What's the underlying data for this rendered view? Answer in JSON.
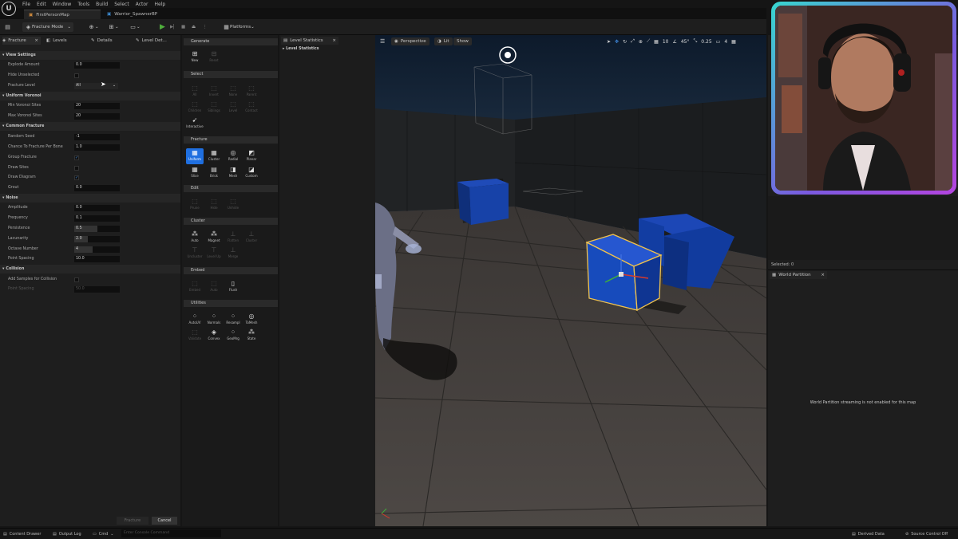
{
  "menubar": {
    "items": [
      "File",
      "Edit",
      "Window",
      "Tools",
      "Build",
      "Select",
      "Actor",
      "Help"
    ]
  },
  "logo": "U",
  "doc_tabs": [
    "FirstPersonMap",
    "Warrior_SpawnerBP"
  ],
  "toolbar": {
    "mode": "Fracture Mode",
    "platforms": "Platforms",
    "icons": [
      "save-icon",
      "mode-icon",
      "add-content-icon",
      "blueprint-icon",
      "cinematics-icon",
      "play-icon",
      "step-icon",
      "stop-icon",
      "eject-icon",
      "more-icon",
      "platforms-icon"
    ]
  },
  "panel_tabs": [
    "Fracture",
    "Levels",
    "Details",
    "Level Det..."
  ],
  "sections": {
    "view": "View Settings",
    "uniform": "Uniform Voronoi",
    "common": "Common Fracture",
    "noise": "Noise",
    "collision": "Collision"
  },
  "props": {
    "explode_amount": {
      "label": "Explode Amount",
      "value": "0.0"
    },
    "hide_unselected": {
      "label": "Hide Unselected"
    },
    "fracture_level": {
      "label": "Fracture Level",
      "value": "All"
    },
    "min_sites": {
      "label": "Min Voronoi Sites",
      "value": "20"
    },
    "max_sites": {
      "label": "Max Voronoi Sites",
      "value": "20"
    },
    "random_seed": {
      "label": "Random Seed",
      "value": "-1"
    },
    "chance": {
      "label": "Chance To Fracture Per Bone",
      "value": "1.0"
    },
    "group_fracture": {
      "label": "Group Fracture"
    },
    "draw_sites": {
      "label": "Draw Sites"
    },
    "draw_diagram": {
      "label": "Draw Diagram"
    },
    "grout": {
      "label": "Grout",
      "value": "0.0"
    },
    "amplitude": {
      "label": "Amplitude",
      "value": "0.0"
    },
    "frequency": {
      "label": "Frequency",
      "value": "0.1"
    },
    "persistence": {
      "label": "Persistence",
      "value": "0.5",
      "level": 0.5
    },
    "lacunarity": {
      "label": "Lacunarity",
      "value": "2.0",
      "level": 0.3
    },
    "octave": {
      "label": "Octave Number",
      "value": "4",
      "level": 0.4
    },
    "point_spacing": {
      "label": "Point Spacing",
      "value": "10.0"
    },
    "add_samples": {
      "label": "Add Samples for Collision"
    },
    "point_spacing2": {
      "label": "Point Spacing",
      "value": "50.0"
    }
  },
  "buttons": {
    "fracture": "Fracture",
    "cancel": "Cancel"
  },
  "tools": {
    "generate": "Generate",
    "select": "Select",
    "fracture": "Fracture",
    "edit": "Edit",
    "cluster": "Cluster",
    "embed": "Embed",
    "utilities": "Utilities",
    "new": "New",
    "reset": "Reset",
    "all": "All",
    "invert": "Invert",
    "none": "None",
    "parent": "Parent",
    "children": "Children",
    "siblings": "Siblings",
    "level": "Level",
    "contact": "Contact",
    "interactive": "Interactive",
    "uniform": "Uniform",
    "clusterf": "Cluster",
    "radial": "Radial",
    "planar": "Planar",
    "slice": "Slice",
    "brick": "Brick",
    "mesh": "Mesh",
    "custom": "Custom",
    "prune": "Prune",
    "hide": "Hide",
    "unhide": "Unhide",
    "auto": "Auto",
    "magnet": "Magnet",
    "flatten": "Flatten",
    "cluster2": "Cluster",
    "uncluster": "Uncluster",
    "level_up": "Level Up",
    "merge": "Merge",
    "embed_b": "Embed",
    "auto_e": "Auto",
    "flush": "Flush",
    "autouv": "AutoUV",
    "normals": "Normals",
    "resample": "Resampl",
    "tomesh": "ToMesh",
    "validate": "Validate",
    "convex": "Convex",
    "geomerge": "GeoMrg",
    "state": "State"
  },
  "stats": {
    "tab": "Level Statistics",
    "item": "Level Statistics"
  },
  "viewport": {
    "perspective": "Perspective",
    "lit": "Lit",
    "show": "Show",
    "fov": "45°",
    "snap": "10",
    "scale": "0.25",
    "speed": "4"
  },
  "world": {
    "selected": "Selected: 0",
    "tab": "World Partition",
    "message": "World Partition streaming is not enabled for this map"
  },
  "status": {
    "drawer": "Content Drawer",
    "output": "Output Log",
    "cmd": "Cmd",
    "console_placeholder": "Enter Console Command",
    "derived": "Derived Data",
    "source": "Source Control Off"
  }
}
